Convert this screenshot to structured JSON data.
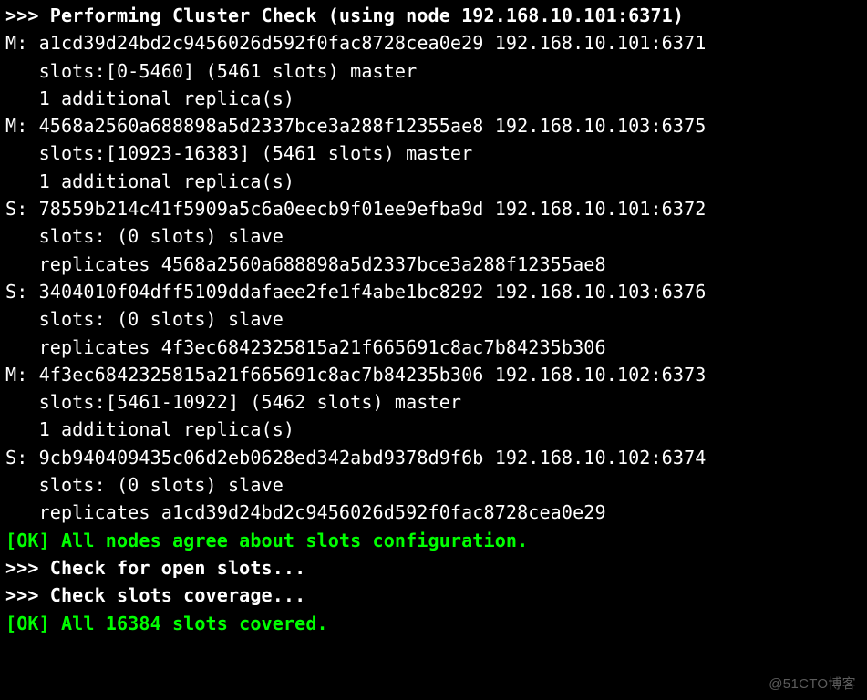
{
  "colors": {
    "bg": "#000000",
    "fg": "#ffffff",
    "ok": "#00ff00",
    "watermark": "#5c5c5c"
  },
  "header": {
    "prompt": ">>> ",
    "text_before": "Performing Cluster Check (using node ",
    "node": "192.168.10.101:6371",
    "text_after": ")"
  },
  "nodes": [
    {
      "role_label": "M:",
      "id": "a1cd39d24bd2c9456026d592f0fac8728cea0e29",
      "addr": "192.168.10.101:6371",
      "slots_line": "   slots:[0-5460] (5461 slots) master",
      "extra_line": "   1 additional replica(s)"
    },
    {
      "role_label": "M:",
      "id": "4568a2560a688898a5d2337bce3a288f12355ae8",
      "addr": "192.168.10.103:6375",
      "slots_line": "   slots:[10923-16383] (5461 slots) master",
      "extra_line": "   1 additional replica(s)"
    },
    {
      "role_label": "S:",
      "id": "78559b214c41f5909a5c6a0eecb9f01ee9efba9d",
      "addr": "192.168.10.101:6372",
      "slots_line": "   slots: (0 slots) slave",
      "extra_line": "   replicates 4568a2560a688898a5d2337bce3a288f12355ae8"
    },
    {
      "role_label": "S:",
      "id": "3404010f04dff5109ddafaee2fe1f4abe1bc8292",
      "addr": "192.168.10.103:6376",
      "slots_line": "   slots: (0 slots) slave",
      "extra_line": "   replicates 4f3ec6842325815a21f665691c8ac7b84235b306"
    },
    {
      "role_label": "M:",
      "id": "4f3ec6842325815a21f665691c8ac7b84235b306",
      "addr": "192.168.10.102:6373",
      "slots_line": "   slots:[5461-10922] (5462 slots) master",
      "extra_line": "   1 additional replica(s)"
    },
    {
      "role_label": "S:",
      "id": "9cb940409435c06d2eb0628ed342abd9378d9f6b",
      "addr": "192.168.10.102:6374",
      "slots_line": "   slots: (0 slots) slave",
      "extra_line": "   replicates a1cd39d24bd2c9456026d592f0fac8728cea0e29"
    }
  ],
  "footer": {
    "ok1": "[OK] All nodes agree about slots configuration.",
    "check_open": ">>> Check for open slots...",
    "check_cov": ">>> Check slots coverage...",
    "ok2": "[OK] All 16384 slots covered."
  },
  "watermark": "@51CTO博客"
}
